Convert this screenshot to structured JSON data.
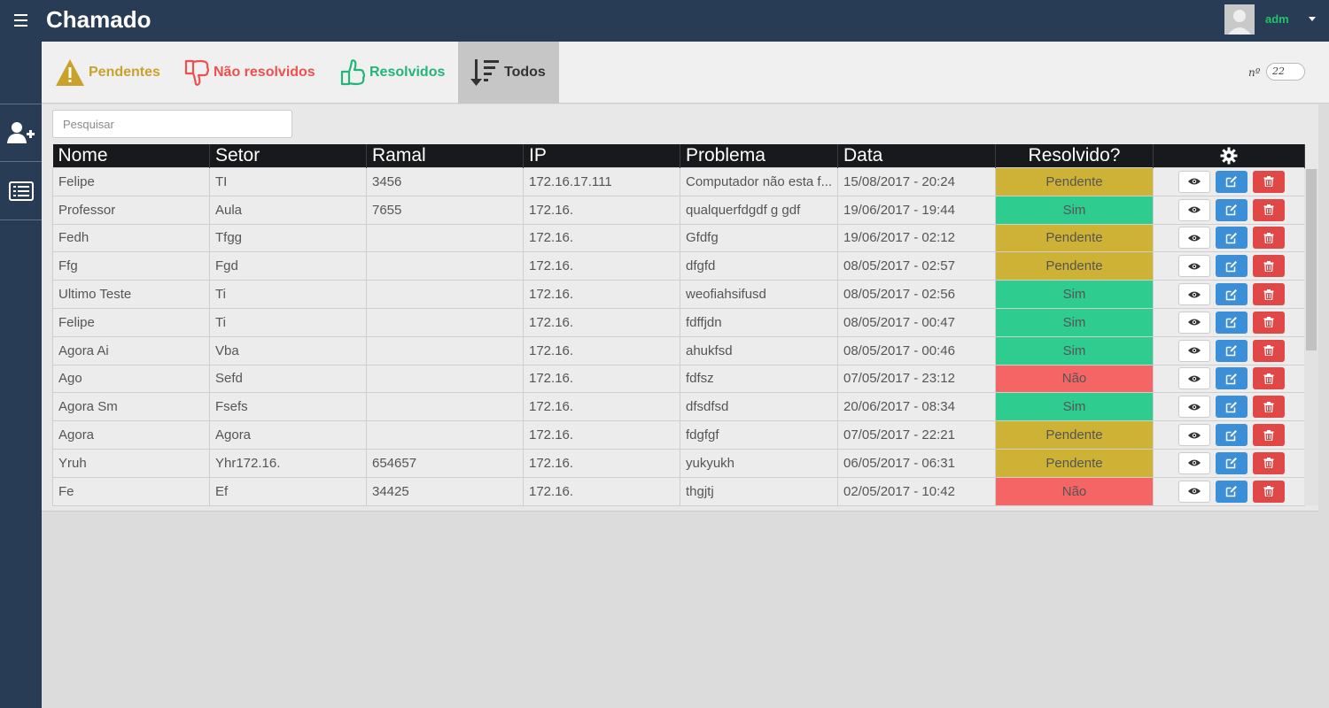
{
  "app": {
    "title": "Chamado"
  },
  "user": {
    "name": "adm"
  },
  "filters": {
    "pendentes": "Pendentes",
    "nao_resolvidos": "Não resolvidos",
    "resolvidos": "Resolvidos",
    "todos": "Todos"
  },
  "counter": {
    "label": "nº",
    "value": "22"
  },
  "search": {
    "placeholder": "Pesquisar"
  },
  "table": {
    "headers": [
      "Nome",
      "Setor",
      "Ramal",
      "IP",
      "Problema",
      "Data",
      "Resolvido?"
    ],
    "rows": [
      {
        "nome": "Felipe",
        "setor": "TI",
        "ramal": "3456",
        "ip": "172.16.17.111",
        "problema": "Computador não esta f...",
        "data": "15/08/2017 - 20:24",
        "status": "Pendente"
      },
      {
        "nome": "Professor",
        "setor": "Aula",
        "ramal": "7655",
        "ip": "172.16.",
        "problema": "qualquerfdgdf g gdf",
        "data": "19/06/2017 - 19:44",
        "status": "Sim"
      },
      {
        "nome": "Fedh",
        "setor": "Tfgg",
        "ramal": "",
        "ip": "172.16.",
        "problema": "Gfdfg",
        "data": "19/06/2017 - 02:12",
        "status": "Pendente"
      },
      {
        "nome": "Ffg",
        "setor": "Fgd",
        "ramal": "",
        "ip": "172.16.",
        "problema": "dfgfd",
        "data": "08/05/2017 - 02:57",
        "status": "Pendente"
      },
      {
        "nome": "Ultimo Teste",
        "setor": "Ti",
        "ramal": "",
        "ip": "172.16.",
        "problema": "weofiahsifusd",
        "data": "08/05/2017 - 02:56",
        "status": "Sim"
      },
      {
        "nome": "Felipe",
        "setor": "Ti",
        "ramal": "",
        "ip": "172.16.",
        "problema": "fdffjdn",
        "data": "08/05/2017 - 00:47",
        "status": "Sim"
      },
      {
        "nome": "Agora Ai",
        "setor": "Vba",
        "ramal": "",
        "ip": "172.16.",
        "problema": "ahukfsd",
        "data": "08/05/2017 - 00:46",
        "status": "Sim"
      },
      {
        "nome": "Ago",
        "setor": "Sefd",
        "ramal": "",
        "ip": "172.16.",
        "problema": "fdfsz",
        "data": "07/05/2017 - 23:12",
        "status": "Não"
      },
      {
        "nome": "Agora Sm",
        "setor": "Fsefs",
        "ramal": "",
        "ip": "172.16.",
        "problema": "dfsdfsd",
        "data": "20/06/2017 - 08:34",
        "status": "Sim"
      },
      {
        "nome": "Agora",
        "setor": "Agora",
        "ramal": "",
        "ip": "172.16.",
        "problema": "fdgfgf",
        "data": "07/05/2017 - 22:21",
        "status": "Pendente"
      },
      {
        "nome": "Yruh",
        "setor": "Yhr172.16.",
        "ramal": "654657",
        "ip": "172.16.",
        "problema": "yukyukh",
        "data": "06/05/2017 - 06:31",
        "status": "Pendente"
      },
      {
        "nome": "Fe",
        "setor": "Ef",
        "ramal": "34425",
        "ip": "172.16.",
        "problema": "thgjtj",
        "data": "02/05/2017 - 10:42",
        "status": "Não"
      }
    ]
  },
  "colors": {
    "topbar": "#283c55",
    "pendente": "#cdb235",
    "sim": "#2ecc8f",
    "nao": "#f56565",
    "edit": "#3b8fd6",
    "delete": "#e04848",
    "user_name": "#21c46a"
  },
  "icons": {
    "menu": "hamburger-icon",
    "add_user": "user-plus-icon",
    "list": "list-icon",
    "pendentes": "warning-icon",
    "nao_resolvidos": "thumbs-down-icon",
    "resolvidos": "thumbs-up-icon",
    "todos": "sort-amount-icon",
    "settings": "gear-icon",
    "view": "eye-icon",
    "edit": "edit-icon",
    "delete": "trash-icon"
  }
}
